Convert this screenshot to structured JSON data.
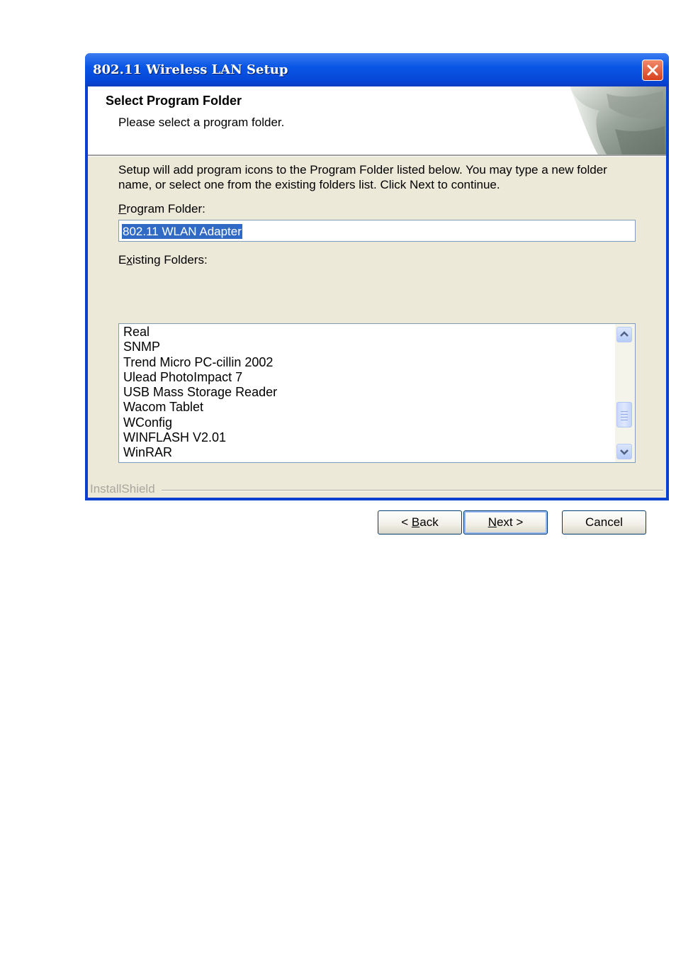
{
  "window": {
    "title": "802.11 Wireless LAN Setup"
  },
  "header": {
    "title": "Select Program Folder",
    "subtitle": "Please select a program folder."
  },
  "body": {
    "description": "Setup will add program icons to the Program Folder listed below.  You may type a new folder name, or select one from the existing folders list.  Click Next to continue.",
    "program_folder_label_pre": "",
    "program_folder_label_accel": "P",
    "program_folder_label_post": "rogram Folder:",
    "program_folder_value": "802.11 WLAN Adapter",
    "existing_folders_label_pre": "E",
    "existing_folders_label_accel": "x",
    "existing_folders_label_post": "isting Folders:",
    "existing_folders": [
      "Real",
      "SNMP",
      "Trend Micro PC-cillin 2002",
      "Ulead PhotoImpact 7",
      "USB Mass Storage Reader",
      "Wacom Tablet",
      "WConfig",
      "WINFLASH V2.01",
      "WinRAR"
    ]
  },
  "footer": {
    "brand": "InstallShield",
    "back_pre": "< ",
    "back_accel": "B",
    "back_post": "ack",
    "next_accel": "N",
    "next_post": "ext >",
    "cancel_label": "Cancel"
  },
  "icons": {
    "close": "close-icon",
    "scroll_up": "chevron-up-icon",
    "scroll_down": "chevron-down-icon"
  }
}
